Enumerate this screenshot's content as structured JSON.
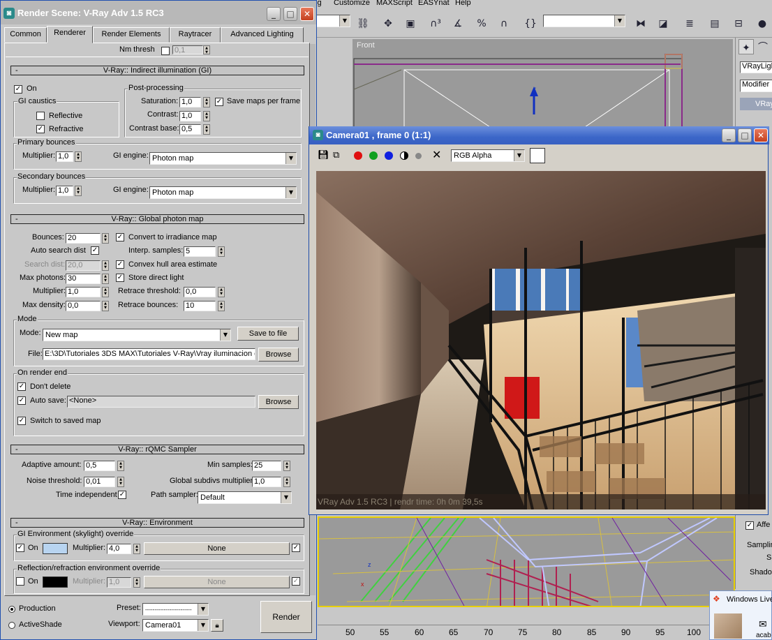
{
  "max_menu": [
    "ing",
    "Customize",
    "MAXScript",
    "EASYnat",
    "Help"
  ],
  "max_viewport_label": "Front",
  "right_panel": {
    "object_type": "VRayLigh",
    "modifier_list": "Modifier L",
    "item": "VRay",
    "affect": "Affe",
    "sampling": "Samplin",
    "s": "S",
    "shadow": "Shado"
  },
  "ruler": [
    "50",
    "55",
    "60",
    "65",
    "70",
    "75",
    "80",
    "85",
    "90",
    "95",
    "100"
  ],
  "taskbar": {
    "windows_live": "Windows Live",
    "user": "acab"
  },
  "render_scene": {
    "title": "Render Scene: V-Ray Adv 1.5 RC3",
    "tabs": [
      "Common",
      "Renderer",
      "Render Elements",
      "Raytracer",
      "Advanced Lighting"
    ],
    "nm_thresh": {
      "label": "Nm thresh",
      "value": "0,1"
    },
    "gi": {
      "header": "V-Ray:: Indirect illumination (GI)",
      "on_label": "On",
      "caustics_title": "GI caustics",
      "reflective": "Reflective",
      "refractive": "Refractive",
      "post_title": "Post-processing",
      "saturation_label": "Saturation:",
      "saturation": "1,0",
      "contrast_label": "Contrast:",
      "contrast": "1,0",
      "contrast_base_label": "Contrast base:",
      "contrast_base": "0,5",
      "save_maps": "Save maps per frame",
      "primary_title": "Primary bounces",
      "primary_mult_label": "Multiplier:",
      "primary_mult": "1,0",
      "primary_engine_label": "GI engine:",
      "primary_engine": "Photon map",
      "secondary_title": "Secondary bounces",
      "secondary_mult_label": "Multiplier:",
      "secondary_mult": "1,0",
      "secondary_engine_label": "GI engine:",
      "secondary_engine": "Photon map"
    },
    "photon": {
      "header": "V-Ray:: Global photon map",
      "bounces_label": "Bounces:",
      "bounces": "20",
      "auto_search_label": "Auto search dist",
      "search_dist_label": "Search dist:",
      "search_dist": "20,0",
      "max_photons_label": "Max photons:",
      "max_photons": "30",
      "multiplier_label": "Multiplier:",
      "multiplier": "1,0",
      "max_density_label": "Max density:",
      "max_density": "0,0",
      "convert_label": "Convert to irradiance map",
      "interp_label": "Interp. samples:",
      "interp": "5",
      "convex_label": "Convex hull area estimate",
      "store_label": "Store direct light",
      "retrace_thresh_label": "Retrace threshold:",
      "retrace_thresh": "0,0",
      "retrace_bounces_label": "Retrace bounces:",
      "retrace_bounces": "10",
      "mode_title": "Mode",
      "mode_label": "Mode:",
      "mode": "New map",
      "save_to_file": "Save to file",
      "file_label": "File:",
      "file": "E:\\3D\\Tutoriales 3DS MAX\\Tutoriales V-Ray\\Vray iluminacion c",
      "browse": "Browse",
      "end_title": "On render end",
      "dont_delete": "Don't delete",
      "auto_save": "Auto save:",
      "auto_save_value": "<None>",
      "browse2": "Browse",
      "switch_saved": "Switch to saved map"
    },
    "qmc": {
      "header": "V-Ray:: rQMC Sampler",
      "adaptive_label": "Adaptive amount:",
      "adaptive": "0,5",
      "noise_label": "Noise threshold:",
      "noise": "0,01",
      "time_label": "Time independent",
      "min_samples_label": "Min samples:",
      "min_samples": "25",
      "global_subdivs_label": "Global subdivs multiplier:",
      "global_subdivs": "1,0",
      "path_label": "Path sampler:",
      "path": "Default"
    },
    "env": {
      "header": "V-Ray:: Environment",
      "gi_title": "GI Environment (skylight) override",
      "on": "On",
      "mult_label": "Multiplier:",
      "mult": "4,0",
      "map": "None",
      "refl_title": "Reflection/refraction environment override",
      "on2": "On",
      "mult2_label": "Multiplier:",
      "mult2": "1,0",
      "map2": "None",
      "sky_color": "#b8d4f0"
    },
    "bottom": {
      "production": "Production",
      "activeshade": "ActiveShade",
      "preset_label": "Preset:",
      "preset": "-------------------------",
      "viewport_label": "Viewport:",
      "viewport": "Camera01",
      "render": "Render"
    }
  },
  "vfb": {
    "title": "Camera01 , frame 0 (1:1)",
    "channel": "RGB Alpha",
    "status": "VRay Adv 1.5 RC3 | rendr time: 0h 0m 39,5s"
  }
}
